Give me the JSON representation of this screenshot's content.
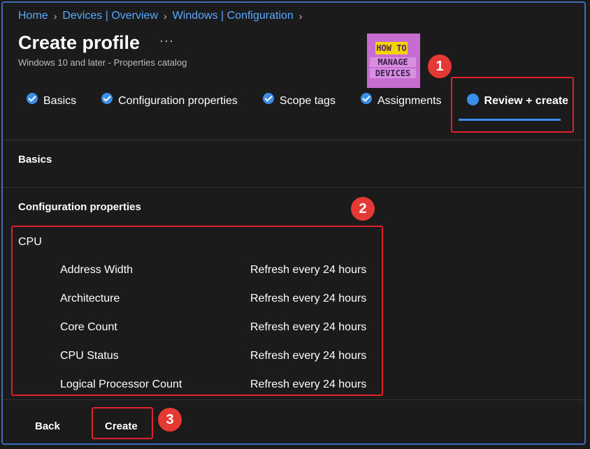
{
  "breadcrumb": [
    "Home",
    "Devices | Overview",
    "Windows | Configuration"
  ],
  "page": {
    "title": "Create profile",
    "more": "···",
    "subtitle": "Windows 10 and later - Properties catalog"
  },
  "logo": {
    "line1": "HOW TO",
    "line2": "MANAGE",
    "line3": "DEVICES"
  },
  "badges": [
    "1",
    "2",
    "3"
  ],
  "tabs": [
    {
      "label": "Basics",
      "state": "done"
    },
    {
      "label": "Configuration properties",
      "state": "done"
    },
    {
      "label": "Scope tags",
      "state": "done"
    },
    {
      "label": "Assignments",
      "state": "done"
    },
    {
      "label": "Review + create",
      "state": "active"
    }
  ],
  "sections": {
    "basics": "Basics",
    "config": "Configuration properties"
  },
  "cpu": {
    "heading": "CPU",
    "rows": [
      {
        "name": "Address Width",
        "value": "Refresh every 24 hours"
      },
      {
        "name": "Architecture",
        "value": "Refresh every 24 hours"
      },
      {
        "name": "Core Count",
        "value": "Refresh every 24 hours"
      },
      {
        "name": "CPU Status",
        "value": "Refresh every 24 hours"
      },
      {
        "name": "Logical Processor Count",
        "value": "Refresh every 24 hours"
      }
    ]
  },
  "footer": {
    "back": "Back",
    "create": "Create"
  },
  "colors": {
    "accent": "#3b8ee8",
    "highlight": "#e0202a",
    "link": "#5aa9ff"
  }
}
